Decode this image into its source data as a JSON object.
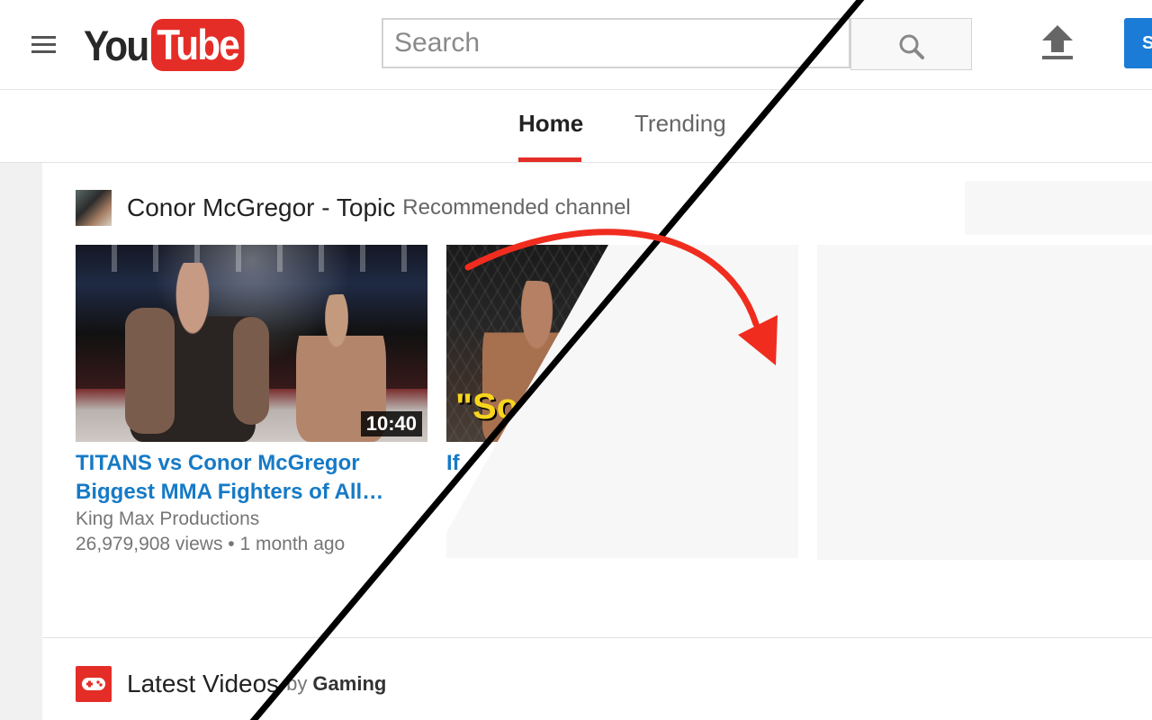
{
  "header": {
    "logo_you": "You",
    "logo_tube": "Tube",
    "search_placeholder": "Search",
    "signin_label": "S"
  },
  "tabs": [
    {
      "label": "Home",
      "active": true
    },
    {
      "label": "Trending",
      "active": false
    }
  ],
  "shelf": {
    "title": "Conor McGregor - Topic",
    "subtitle": "Recommended channel",
    "videos": [
      {
        "duration": "10:40",
        "title_line1": "TITANS vs Conor McGregor",
        "title_line2": "Biggest MMA Fighters of All…",
        "channel": "King Max Productions",
        "views": "26,979,908 views",
        "age": "1 month ago"
      },
      {
        "thumb_text": "\"So",
        "title_fragment": "If"
      }
    ]
  },
  "latest": {
    "title": "Latest Videos",
    "by": "by",
    "channel": "Gaming"
  },
  "colors": {
    "brand_red": "#e52d27",
    "link_blue": "#167ac6",
    "signin_blue": "#1b7cd8"
  },
  "icons": [
    "menu-icon",
    "search-icon",
    "upload-icon",
    "gaming-controller-icon"
  ]
}
